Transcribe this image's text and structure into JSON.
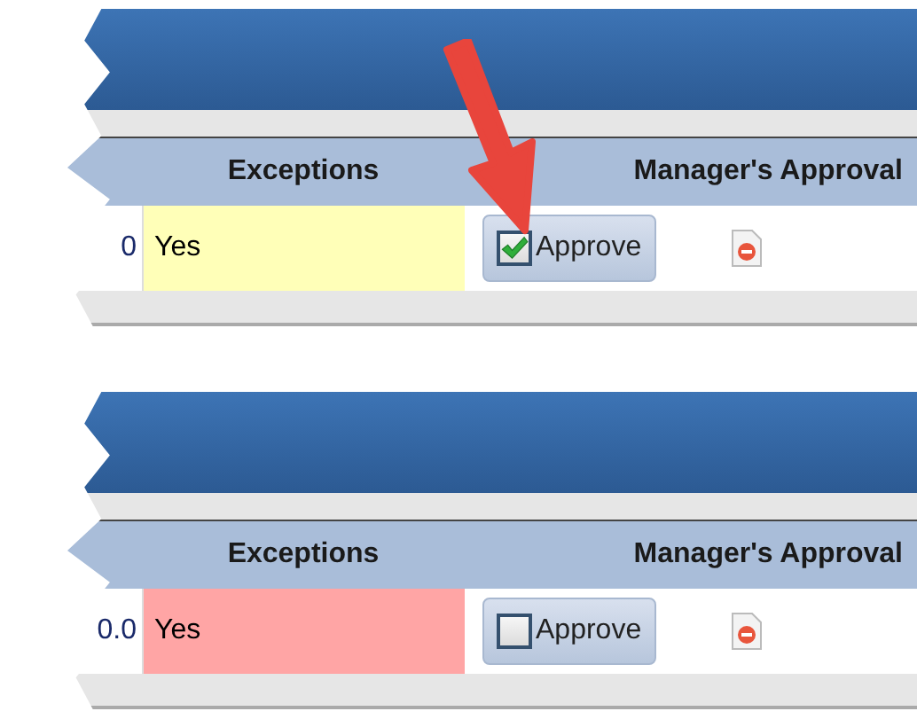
{
  "panels": [
    {
      "columns": [
        "Exceptions",
        "Manager's Approval"
      ],
      "row": {
        "amount": "0",
        "exceptions": "Yes",
        "color": "#ffffb8",
        "approve": {
          "label": "Approve",
          "checked": true
        }
      }
    },
    {
      "columns": [
        "Exceptions",
        "Manager's Approval"
      ],
      "row": {
        "amount": "0.0",
        "exceptions": "Yes",
        "color": "#ffa5a5",
        "approve": {
          "label": "Approve",
          "checked": false
        }
      }
    }
  ]
}
